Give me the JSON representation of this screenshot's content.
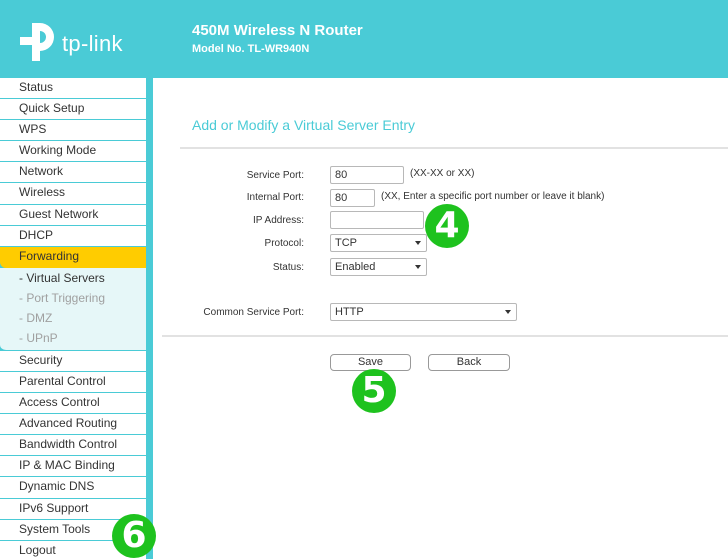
{
  "header": {
    "brand": "tp-link",
    "product_title": "450M Wireless N Router",
    "model_no": "Model No. TL-WR940N",
    "color": "#4acbd6"
  },
  "sidebar": {
    "items_before": [
      {
        "label": "Status"
      },
      {
        "label": "Quick Setup"
      },
      {
        "label": "WPS"
      },
      {
        "label": "Working Mode"
      },
      {
        "label": "Network"
      },
      {
        "label": "Wireless"
      },
      {
        "label": "Guest Network"
      },
      {
        "label": "DHCP"
      }
    ],
    "active": {
      "label": "Forwarding",
      "color": "#ffcc00"
    },
    "submenu": [
      {
        "label": "- Virtual Servers",
        "current": true
      },
      {
        "label": "- Port Triggering",
        "current": false
      },
      {
        "label": "- DMZ",
        "current": false
      },
      {
        "label": "- UPnP",
        "current": false
      }
    ],
    "items_after": [
      {
        "label": "Security"
      },
      {
        "label": "Parental Control"
      },
      {
        "label": "Access Control"
      },
      {
        "label": "Advanced Routing"
      },
      {
        "label": "Bandwidth Control"
      },
      {
        "label": "IP & MAC Binding"
      },
      {
        "label": "Dynamic DNS"
      },
      {
        "label": "IPv6 Support"
      },
      {
        "label": "System Tools"
      },
      {
        "label": "Logout"
      }
    ]
  },
  "main": {
    "title": "Add or Modify a Virtual Server Entry",
    "form": {
      "service_port": {
        "label": "Service Port:",
        "value": "80",
        "hint": "(XX-XX or XX)"
      },
      "internal_port": {
        "label": "Internal Port:",
        "value": "80",
        "hint": "(XX, Enter a specific port number or leave it blank)"
      },
      "ip_address": {
        "label": "IP Address:",
        "value": ""
      },
      "protocol": {
        "label": "Protocol:",
        "value": "TCP"
      },
      "status": {
        "label": "Status:",
        "value": "Enabled"
      },
      "common_service_port": {
        "label": "Common Service Port:",
        "value": "HTTP"
      }
    },
    "buttons": {
      "save": "Save",
      "back": "Back"
    }
  },
  "annotations": {
    "step4": "4",
    "step5": "5",
    "step6": "6",
    "color": "#1ec21e"
  }
}
